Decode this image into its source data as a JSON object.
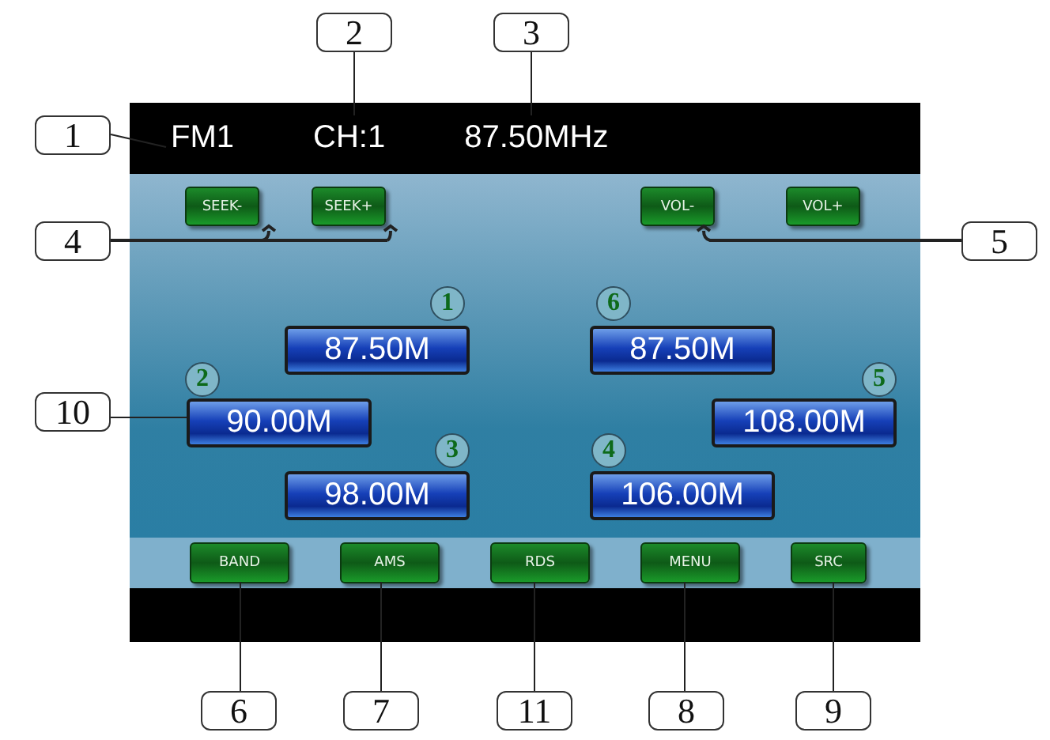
{
  "status_bar": {
    "band": "FM1",
    "channel": "CH:1",
    "frequency": "87.50MHz"
  },
  "top_buttons": [
    {
      "label": "SEEK-"
    },
    {
      "label": "SEEK+"
    },
    {
      "label": "VOL-"
    },
    {
      "label": "VOL+"
    }
  ],
  "presets": [
    {
      "number": "1",
      "frequency": "87.50M"
    },
    {
      "number": "6",
      "frequency": "87.50M"
    },
    {
      "number": "2",
      "frequency": "90.00M"
    },
    {
      "number": "5",
      "frequency": "108.00M"
    },
    {
      "number": "3",
      "frequency": "98.00M"
    },
    {
      "number": "4",
      "frequency": "106.00M"
    }
  ],
  "bottom_buttons": [
    {
      "label": "BAND"
    },
    {
      "label": "AMS"
    },
    {
      "label": "RDS"
    },
    {
      "label": "MENU"
    },
    {
      "label": "SRC"
    }
  ],
  "callouts": [
    "1",
    "2",
    "3",
    "4",
    "5",
    "10",
    "6",
    "7",
    "11",
    "8",
    "9"
  ]
}
